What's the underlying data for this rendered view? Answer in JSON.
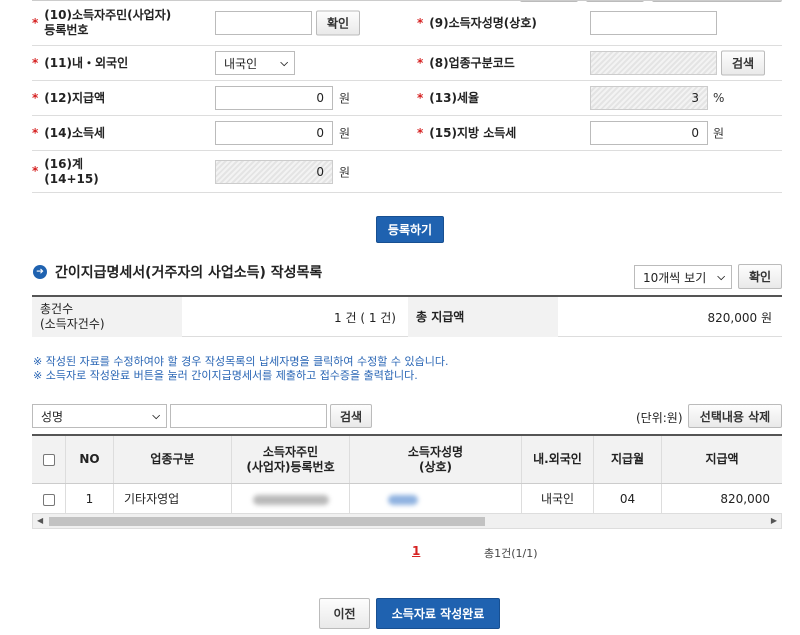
{
  "form": {
    "id_label_1": "(10)소득자주민(사업자)",
    "id_label_2": "등록번호",
    "confirm_label": "확인",
    "name_label": "(9)소득자성명(상호)",
    "nationality_label": "(11)내・외국인",
    "nationality_value": "내국인",
    "biz_code_label": "(8)업종구분코드",
    "search_label": "검색",
    "payment_label": "(12)지급액",
    "payment_value": "0",
    "tax_rate_label": "(13)세율",
    "tax_rate_value": "3",
    "income_tax_label": "(14)소득세",
    "income_tax_value": "0",
    "local_tax_label": "(15)지방 소득세",
    "local_tax_value": "0",
    "total_label_1": "(16)계",
    "total_label_2": "(14+15)",
    "total_value": "0",
    "unit_won": "원",
    "unit_percent": "%",
    "register_button": "등록하기"
  },
  "list": {
    "title": "간이지급명세서(거주자의 사업소득) 작성목록",
    "page_size": "10개씩 보기",
    "confirm_label": "확인",
    "summary": {
      "count_label_1": "총건수",
      "count_label_2": "(소득자건수)",
      "count_value": "1 건 ( 1 건)",
      "total_label": "총 지급액",
      "total_value": "820,000 원"
    },
    "notes": [
      "※ 작성된 자료를 수정하여야 할 경우 작성목록의 납세자명을 클릭하여 수정할 수 있습니다.",
      "※ 소득자로 작성완료 버튼을 눌러 간이지급명세서를 제출하고 접수증을 출력합니다."
    ],
    "filter": {
      "field": "성명",
      "query": "",
      "search_label": "검색",
      "unit_text": "(단위:원)",
      "delete_label": "선택내용 삭제"
    },
    "columns": {
      "no": "NO",
      "biz": "업종구분",
      "id_1": "소득자주민",
      "id_2": "(사업자)등록번호",
      "name_1": "소득자성명",
      "name_2": "(상호)",
      "nat": "내.외국인",
      "month": "지급월",
      "amount": "지급액"
    },
    "rows": [
      {
        "no": "1",
        "biz": "기타자영업",
        "nat": "내국인",
        "month": "04",
        "amount": "820,000"
      }
    ],
    "pagination": {
      "current": "1",
      "summary": "총1건(1/1)"
    }
  },
  "footer": {
    "prev_label": "이전",
    "complete_label": "소득자료 작성완료"
  },
  "colors": {
    "accent": "#1f62b0",
    "required": "#d62222",
    "note": "#2a66b5"
  }
}
